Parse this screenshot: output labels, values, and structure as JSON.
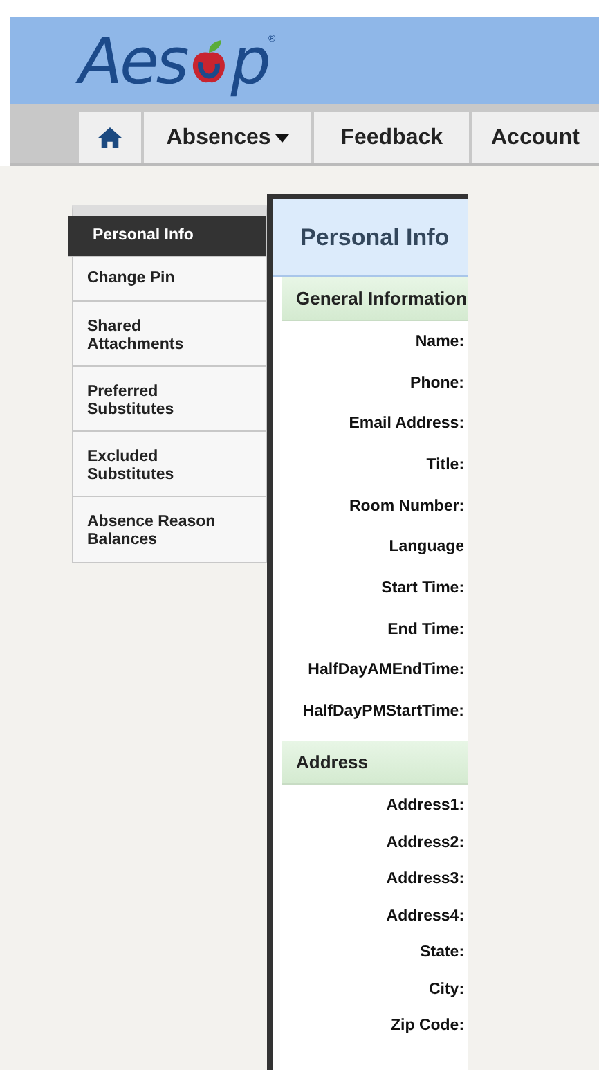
{
  "logo": {
    "before": "Aes",
    "after": "p",
    "mark": "®"
  },
  "nav": [
    {
      "kind": "home",
      "selected": false
    },
    {
      "kind": "menu",
      "label": "Absences",
      "selected": false
    },
    {
      "kind": "link",
      "label": "Feedback",
      "selected": false
    },
    {
      "kind": "link",
      "label": "Account",
      "selected": false
    }
  ],
  "sidebar": {
    "items": [
      {
        "label": "Personal Info",
        "selected": true
      },
      {
        "label": "Change Pin",
        "selected": false
      },
      {
        "label": "Shared Attachments",
        "selected": false
      },
      {
        "label": "Preferred Substitutes",
        "selected": false
      },
      {
        "label": "Excluded Substitutes",
        "selected": false
      },
      {
        "label": "Absence Reason Balances",
        "selected": false
      }
    ]
  },
  "panel": {
    "title": "Personal Info",
    "sections": [
      {
        "title": "General Information",
        "fields": [
          "Name:",
          "Phone:",
          "Email Address:",
          "Title:",
          "Room Number:",
          "Language",
          "Start Time:",
          "End Time:",
          "HalfDayAMEndTime:",
          "HalfDayPMStartTime:"
        ]
      },
      {
        "title": "Address",
        "fields": [
          "Address1:",
          "Address2:",
          "Address3:",
          "Address4:",
          "State:",
          "City:",
          "Zip Code:"
        ]
      }
    ]
  }
}
